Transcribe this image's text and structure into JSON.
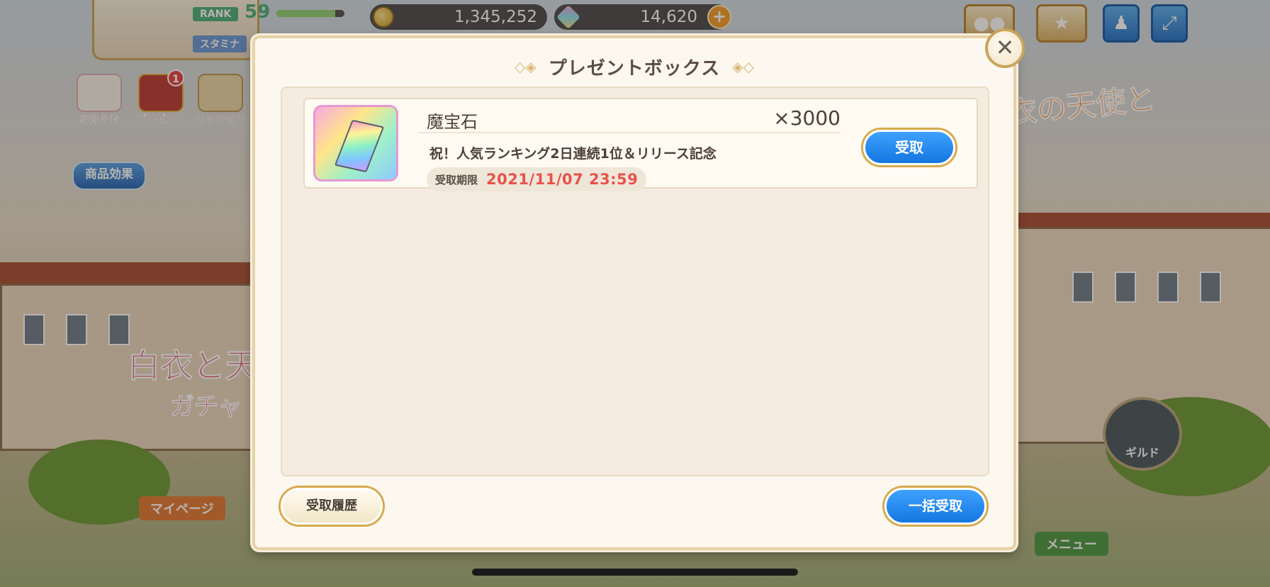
{
  "hud": {
    "rank_label": "RANK",
    "rank_value": "59",
    "rank_progress": 0.86,
    "stamina_label": "スタミナ",
    "coins": "1,345,252",
    "gems": "14,620",
    "add_gems_label": "+"
  },
  "side_menu": {
    "news_label": "お知らせ",
    "present_label": "プレゼント",
    "present_badge": "1",
    "mission_label": "ミッション",
    "effect_label": "商品効果"
  },
  "background": {
    "banner_text": "衣の天使と",
    "gacha_text": "白衣と天使",
    "gacha_sub": "ガチャ"
  },
  "bottom_nav": {
    "mypage_label": "マイページ",
    "menu_label": "メニュー",
    "guild_label": "ギルド"
  },
  "modal": {
    "title": "プレゼントボックス",
    "close_label": "✕",
    "gifts": [
      {
        "name": "魔宝石",
        "quantity": "×3000",
        "description": "祝！人気ランキング2日連続1位＆リリース記念",
        "expire_label": "受取期限",
        "expire_date": "2021/11/07 23:59",
        "receive_label": "受取"
      }
    ],
    "history_label": "受取履歴",
    "bulk_receive_label": "一括受取"
  },
  "colors": {
    "accent_blue": "#1476e0",
    "expire_red": "#e8524a",
    "gold_border": "#d6a94a"
  }
}
